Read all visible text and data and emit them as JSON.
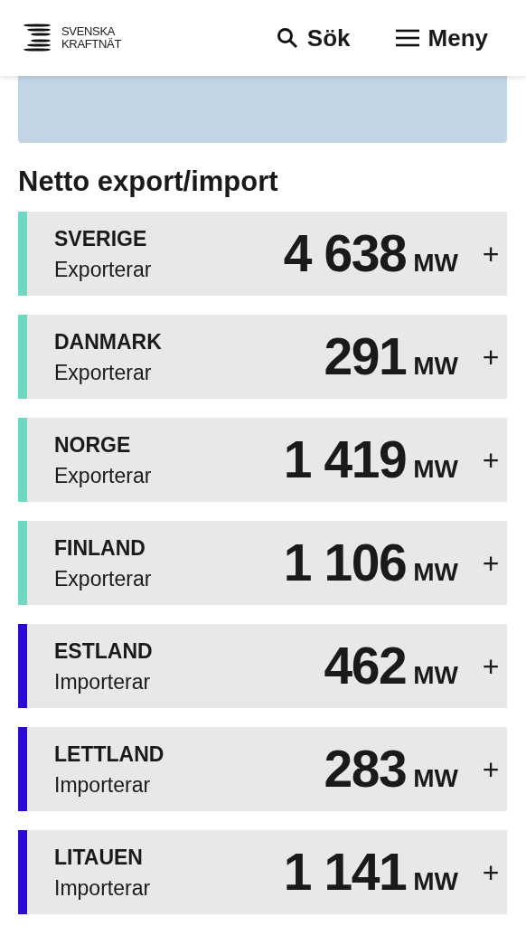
{
  "header": {
    "logo": [
      "SVENSKA",
      "KRAFTNÄT"
    ],
    "search": "Sök",
    "menu": "Meny"
  },
  "section": {
    "title": "Netto export/import",
    "rows": [
      {
        "country": "SVERIGE",
        "direction": "Exporterar",
        "value": "4 638",
        "unit": "MW",
        "toggle": "+",
        "color": "#6fd8c3"
      },
      {
        "country": "DANMARK",
        "direction": "Exporterar",
        "value": "291",
        "unit": "MW",
        "toggle": "+",
        "color": "#6fd8c3"
      },
      {
        "country": "NORGE",
        "direction": "Exporterar",
        "value": "1 419",
        "unit": "MW",
        "toggle": "+",
        "color": "#6fd8c3"
      },
      {
        "country": "FINLAND",
        "direction": "Exporterar",
        "value": "1 106",
        "unit": "MW",
        "toggle": "+",
        "color": "#6fd8c3"
      },
      {
        "country": "ESTLAND",
        "direction": "Importerar",
        "value": "462",
        "unit": "MW",
        "toggle": "+",
        "color": "#2a0bd6"
      },
      {
        "country": "LETTLAND",
        "direction": "Importerar",
        "value": "283",
        "unit": "MW",
        "toggle": "+",
        "color": "#2a0bd6"
      },
      {
        "country": "LITAUEN",
        "direction": "Importerar",
        "value": "1 141",
        "unit": "MW",
        "toggle": "+",
        "color": "#2a0bd6"
      }
    ]
  }
}
